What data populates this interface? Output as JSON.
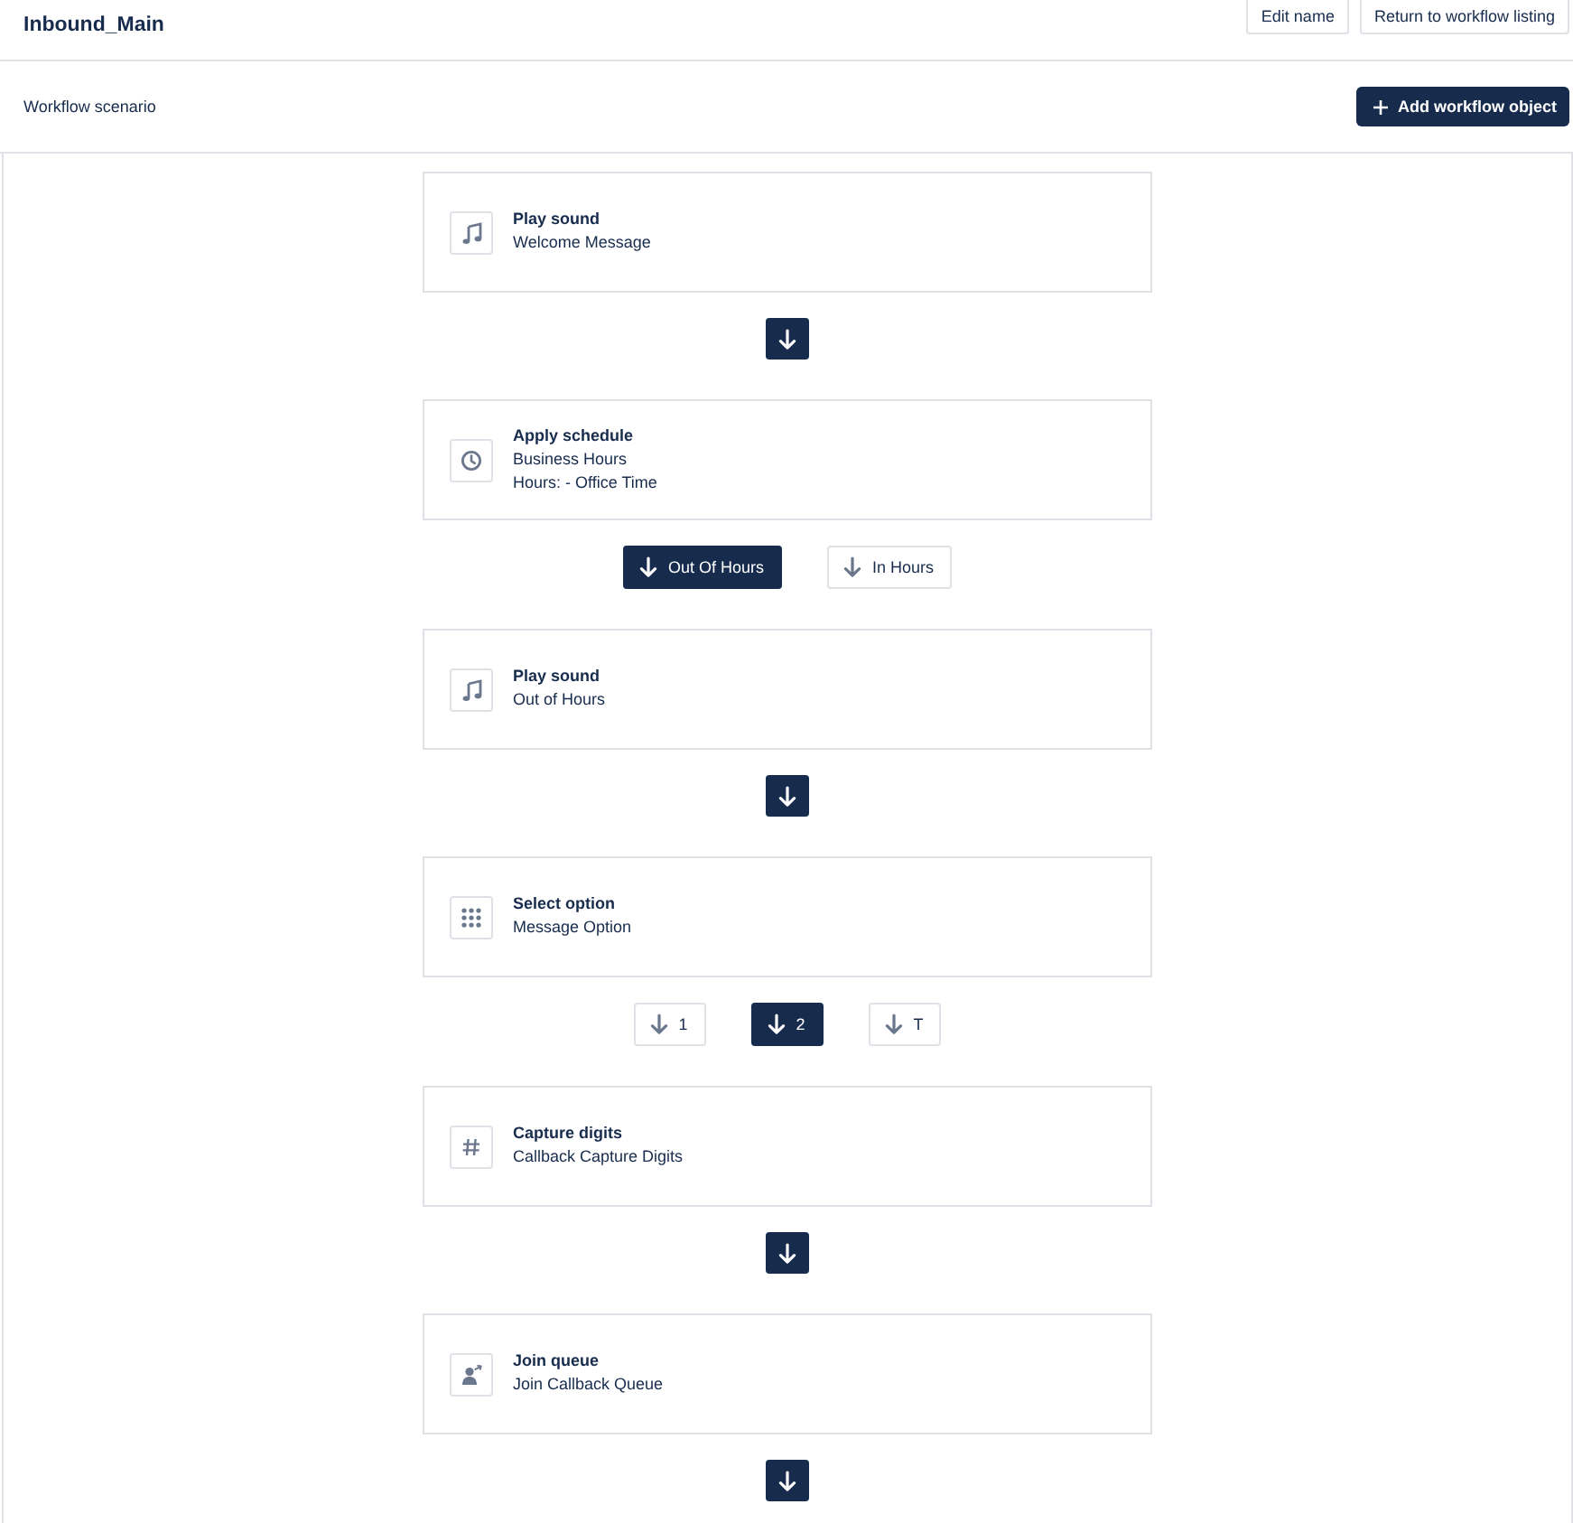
{
  "header": {
    "title": "Inbound_Main",
    "buttons": [
      {
        "label": "Edit name"
      },
      {
        "label": "Return to workflow listing"
      }
    ]
  },
  "toolbar": {
    "label": "Workflow scenario",
    "add_button": {
      "label": "Add workflow object"
    }
  },
  "steps": [
    {
      "kind": "play_sound",
      "title": "Play sound",
      "details": [
        "Welcome Message"
      ],
      "next": {
        "kind": "arrow"
      }
    },
    {
      "kind": "schedule",
      "title": "Apply schedule",
      "details": [
        "Business Hours",
        "Hours: - Office Time"
      ],
      "next": {
        "kind": "branches",
        "branches": [
          {
            "label": "Out Of Hours",
            "selected": true
          },
          {
            "label": "In Hours",
            "selected": false
          }
        ]
      }
    },
    {
      "kind": "play_sound",
      "title": "Play sound",
      "details": [
        "Out of Hours"
      ],
      "next": {
        "kind": "arrow"
      }
    },
    {
      "kind": "select_option",
      "title": "Select option",
      "details": [
        "Message Option"
      ],
      "next": {
        "kind": "branches",
        "branches": [
          {
            "label": "1",
            "selected": false
          },
          {
            "label": "2",
            "selected": true
          },
          {
            "label": "T",
            "selected": false
          }
        ]
      }
    },
    {
      "kind": "capture_digits",
      "title": "Capture digits",
      "details": [
        "Callback Capture Digits"
      ],
      "next": {
        "kind": "arrow"
      }
    },
    {
      "kind": "join_queue",
      "title": "Join queue",
      "details": [
        "Join Callback Queue"
      ],
      "next": {
        "kind": "arrow"
      }
    }
  ]
}
